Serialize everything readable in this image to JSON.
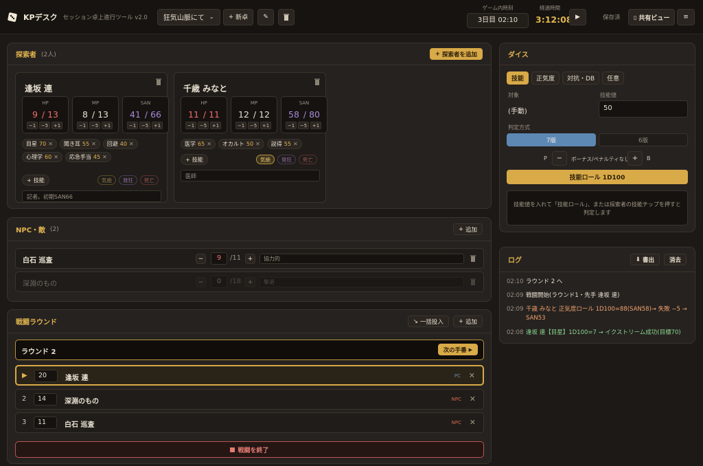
{
  "app": {
    "name": "KPデスク",
    "subtitle": "セッション卓上進行ツール v2.0"
  },
  "toolbar": {
    "scenario": "狂気山脈にて",
    "new_table": "新卓",
    "game_time_label": "ゲーム内時刻",
    "game_time": "3日目 02:10",
    "elapsed_label": "経過時間",
    "elapsed": "3:12:08",
    "saved": "保存済",
    "share_view": "共有ビュー"
  },
  "investigators": {
    "title": "探索者",
    "count": "(2人)",
    "add_label": "探索者を追加",
    "cards": [
      {
        "name": "逢坂 連",
        "stats": [
          {
            "label": "HP",
            "cur": "9",
            "max": "13",
            "color": "#ef6d6d"
          },
          {
            "label": "MP",
            "cur": "8",
            "max": "13",
            "color": "#f2ead8"
          },
          {
            "label": "SAN",
            "cur": "41",
            "max": "66",
            "color": "#a98ad8"
          }
        ],
        "skills": [
          {
            "name": "目星",
            "value": "70"
          },
          {
            "name": "聞き耳",
            "value": "55"
          },
          {
            "name": "回避",
            "value": "40"
          },
          {
            "name": "心理学",
            "value": "60"
          },
          {
            "name": "応急手当",
            "value": "45"
          }
        ],
        "memo": "記者。初期SAN66"
      },
      {
        "name": "千歳 みなと",
        "stats": [
          {
            "label": "HP",
            "cur": "11",
            "max": "11",
            "color": "#ef6d6d"
          },
          {
            "label": "MP",
            "cur": "12",
            "max": "12",
            "color": "#f2ead8"
          },
          {
            "label": "SAN",
            "cur": "58",
            "max": "80",
            "color": "#a98ad8"
          }
        ],
        "skills": [
          {
            "name": "医学",
            "value": "65"
          },
          {
            "name": "オカルト",
            "value": "50"
          },
          {
            "name": "説得",
            "value": "55"
          }
        ],
        "memo": "医師"
      }
    ],
    "adjust": [
      "−1",
      "−5",
      "+1"
    ],
    "add_skill": "技能",
    "status": [
      "気絶",
      "発狂",
      "死亡"
    ]
  },
  "npc": {
    "title": "NPC・敵",
    "count": "(2)",
    "add_label": "追加",
    "rows": [
      {
        "name": "白石 巡査",
        "hp": "9",
        "max": "/11",
        "note": "協力的"
      },
      {
        "name": "深淵のもの",
        "hp": "0",
        "max": "/18",
        "note": "撃退"
      }
    ]
  },
  "combat": {
    "title": "戦闘ラウンド",
    "bulk_label": "一括投入",
    "add_label": "追加",
    "round": "ラウンド 2",
    "next_turn": "次の手番",
    "turns": [
      {
        "idx": "",
        "init": "20",
        "name": "逢坂 連",
        "type": "PC"
      },
      {
        "idx": "2",
        "init": "14",
        "name": "深淵のもの",
        "type": "NPC"
      },
      {
        "idx": "3",
        "init": "11",
        "name": "白石 巡査",
        "type": "NPC"
      }
    ],
    "end": "戦闘を終了"
  },
  "dice": {
    "title": "ダイス",
    "tabs": [
      "技能",
      "正気度",
      "対抗・DB",
      "任意"
    ],
    "target_label": "対象",
    "target": "(手動)",
    "skill_label": "技能値",
    "skill_value": "50",
    "method_label": "判定方式",
    "methods": [
      "7版",
      "6版"
    ],
    "p_label": "P",
    "bonus_label": "ボーナス/ペナルティなし",
    "b_label": "B",
    "roll": "技能ロール 1D100",
    "result": "技能値を入れて「技能ロール」、または探索者の技能チップを押すと判定します"
  },
  "log": {
    "title": "ログ",
    "export": "書出",
    "clear": "消去",
    "entries": [
      {
        "time": "02:10",
        "text": "ラウンド 2 へ",
        "kind": "normal"
      },
      {
        "time": "02:09",
        "text": "戦闘開始(ラウンド1・先手 逢坂 連)",
        "kind": "normal"
      },
      {
        "time": "02:09",
        "text": "千歳 みなと 正気度ロール 1D100=88(SAN58)→ 失敗 −5 → SAN53",
        "kind": "san"
      },
      {
        "time": "02:08",
        "text": "逢坂 連【目星】1D100=7 → イクストリーム成功(目標70)",
        "kind": "succ"
      }
    ]
  }
}
